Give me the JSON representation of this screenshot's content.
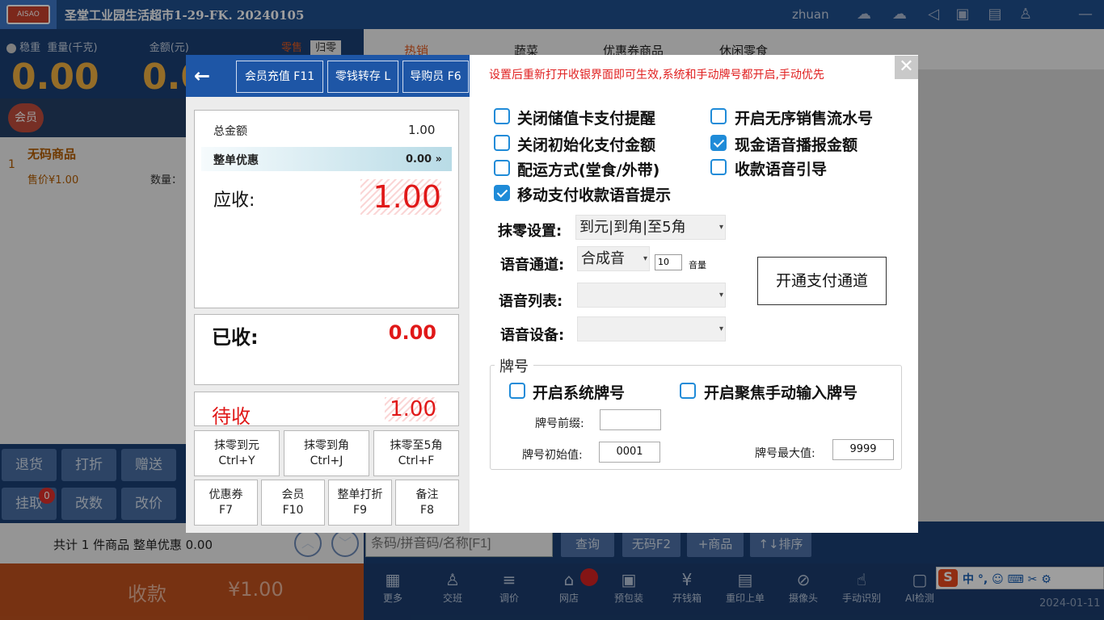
{
  "topbar": {
    "logo_text": "AISAO",
    "shop_title": "圣堂工业园生活超市1-29-FK. 20240105",
    "username": "zhuan",
    "icons": [
      "cloud-icon",
      "cloud-upload-icon",
      "volume-icon",
      "lock-icon",
      "printer-icon",
      "shirt-icon",
      "minimize-icon"
    ]
  },
  "scale": {
    "stable": "稳重",
    "weight_label": "重量(千克)",
    "amount_label": "金额(元)",
    "mode_retail": "零售",
    "mode_return": "归零",
    "weight_value": "0.00",
    "amount_value": "0.0"
  },
  "member": {
    "label": "会员"
  },
  "cart": {
    "index": "1",
    "item_name": "无码商品",
    "price": "售价¥1.00",
    "qty_label": "数量："
  },
  "ops": [
    "退货",
    "打折",
    "赠送",
    "挂取",
    "改数",
    "改价"
  ],
  "ops_badge": "0",
  "summary": "共计 1 件商品 整单优惠 0.00",
  "pay": {
    "label": "收款",
    "amount": "¥1.00"
  },
  "tabs": [
    "热销",
    "蔬菜",
    "优惠券商品",
    "休闲零食"
  ],
  "search": {
    "placeholder": "条码/拼音码/名称[F1]",
    "buttons": [
      "查询",
      "无码F2",
      "+商品",
      "↑↓排序"
    ]
  },
  "bottom": [
    {
      "icon": "grid-icon",
      "label": "更多"
    },
    {
      "icon": "user-icon",
      "label": "交班"
    },
    {
      "icon": "adjust-icon",
      "label": "调价"
    },
    {
      "icon": "store-icon",
      "label": "网店"
    },
    {
      "icon": "package-icon",
      "label": "预包装"
    },
    {
      "icon": "cashbox-icon",
      "label": "开钱箱"
    },
    {
      "icon": "printer-icon",
      "label": "重印上单"
    },
    {
      "icon": "camera-icon",
      "label": "摄像头"
    },
    {
      "icon": "hand-icon",
      "label": "手动识别"
    },
    {
      "icon": "ai-icon",
      "label": "AI检测"
    }
  ],
  "date": "2024-01-11",
  "ime": {
    "text": "中 °, ☺ ⌨ ✂ ⚙"
  },
  "dialog": {
    "header_buttons": [
      "会员充值 F11",
      "零钱转存 L",
      "导购员 F6"
    ],
    "total_label": "总金额",
    "total_value": "1.00",
    "discount_label": "整单优惠",
    "discount_value": "0.00",
    "receivable_label": "应收:",
    "receivable_value": "1.00",
    "received_label": "已收:",
    "received_value": "0.00",
    "pending_label": "待收",
    "pending_value": "1.00",
    "keys": [
      {
        "l1": "抹零到元",
        "l2": "Ctrl+Y"
      },
      {
        "l1": "抹零到角",
        "l2": "Ctrl+J"
      },
      {
        "l1": "抹零至5角",
        "l2": "Ctrl+F"
      },
      {
        "l1": "优惠券",
        "l2": "F7"
      },
      {
        "l1": "会员",
        "l2": "F10"
      },
      {
        "l1": "整单打折",
        "l2": "F9"
      },
      {
        "l1": "备注",
        "l2": "F8"
      }
    ],
    "notice": "设置后重新打开收银界面即可生效,系统和手动牌号都开启,手动优先",
    "options": [
      {
        "label": "关闭储值卡支付提醒",
        "checked": false
      },
      {
        "label": "开启无序销售流水号",
        "checked": false
      },
      {
        "label": "关闭初始化支付金额",
        "checked": false
      },
      {
        "label": "现金语音播报金额",
        "checked": true
      },
      {
        "label": "配运方式(堂食/外带)",
        "checked": false
      },
      {
        "label": "收款语音引导",
        "checked": false
      },
      {
        "label": "移动支付收款语音提示",
        "checked": true
      }
    ],
    "rounding_label": "抹零设置:",
    "rounding_value": "到元|到角|至5角",
    "voice_channel_label": "语音通道:",
    "voice_channel_value": "合成音",
    "volume_value": "10",
    "volume_unit": "音量",
    "voice_list_label": "语音列表:",
    "voice_device_label": "语音设备:",
    "pay_channel_button": "开通支付通道",
    "plate_group": "牌号",
    "plate_system": "开启系统牌号",
    "plate_focus": "开启聚焦手动输入牌号",
    "plate_prefix_label": "牌号前缀:",
    "plate_prefix_value": "",
    "plate_start_label": "牌号初始值:",
    "plate_start_value": "0001",
    "plate_max_label": "牌号最大值:",
    "plate_max_value": "9999"
  }
}
